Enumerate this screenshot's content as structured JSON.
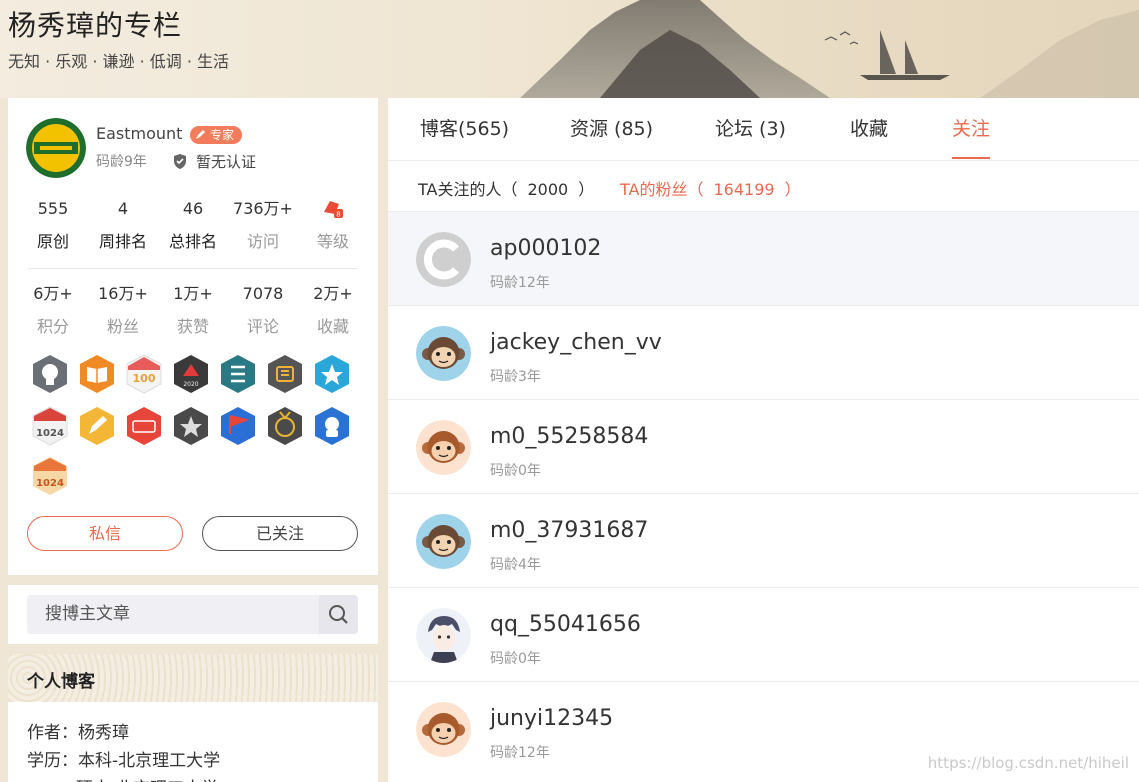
{
  "header": {
    "title": "杨秀璋的专栏",
    "subtitle": "无知 · 乐观 · 谦逊 · 低调 · 生活"
  },
  "profile": {
    "username": "Eastmount",
    "badge": "专家",
    "coding_age": "码龄9年",
    "certification": "暂无认证",
    "stats_row1": [
      {
        "value": "555",
        "label": "原创"
      },
      {
        "value": "4",
        "label": "周排名"
      },
      {
        "value": "46",
        "label": "总排名"
      },
      {
        "value": "736万+",
        "label": "访问"
      },
      {
        "value": "",
        "label": "等级"
      }
    ],
    "stats_row2": [
      {
        "value": "6万+",
        "label": "积分"
      },
      {
        "value": "16万+",
        "label": "粉丝"
      },
      {
        "value": "1万+",
        "label": "获赞"
      },
      {
        "value": "7078",
        "label": "评论"
      },
      {
        "value": "2万+",
        "label": "收藏"
      }
    ],
    "message_button": "私信",
    "follow_button": "已关注"
  },
  "search": {
    "placeholder": "搜博主文章"
  },
  "blog_info": {
    "title": "个人博客",
    "author": "作者：杨秀璋",
    "education": "学历：本科-北京理工大学",
    "education2": "硕士-北京理工大学"
  },
  "tabs": [
    {
      "label": "博客(565)"
    },
    {
      "label": "资源 (85)"
    },
    {
      "label": "论坛 (3)"
    },
    {
      "label": "收藏"
    },
    {
      "label": "关注"
    }
  ],
  "subtabs": {
    "following_prefix": "TA关注的人（",
    "following_count": "2000",
    "following_suffix": "）",
    "fans_prefix": "TA的粉丝（",
    "fans_count": "164199",
    "fans_suffix": "）"
  },
  "users": [
    {
      "name": "ap000102",
      "age": "码龄12年"
    },
    {
      "name": "jackey_chen_vv",
      "age": "码龄3年"
    },
    {
      "name": "m0_55258584",
      "age": "码龄0年"
    },
    {
      "name": "m0_37931687",
      "age": "码龄4年"
    },
    {
      "name": "qq_55041656",
      "age": "码龄0年"
    },
    {
      "name": "junyi12345",
      "age": "码龄12年"
    }
  ],
  "watermark": "https://blog.csdn.net/hiheil",
  "colors": {
    "accent": "#e96a4f",
    "banner": "#efe5d2"
  }
}
